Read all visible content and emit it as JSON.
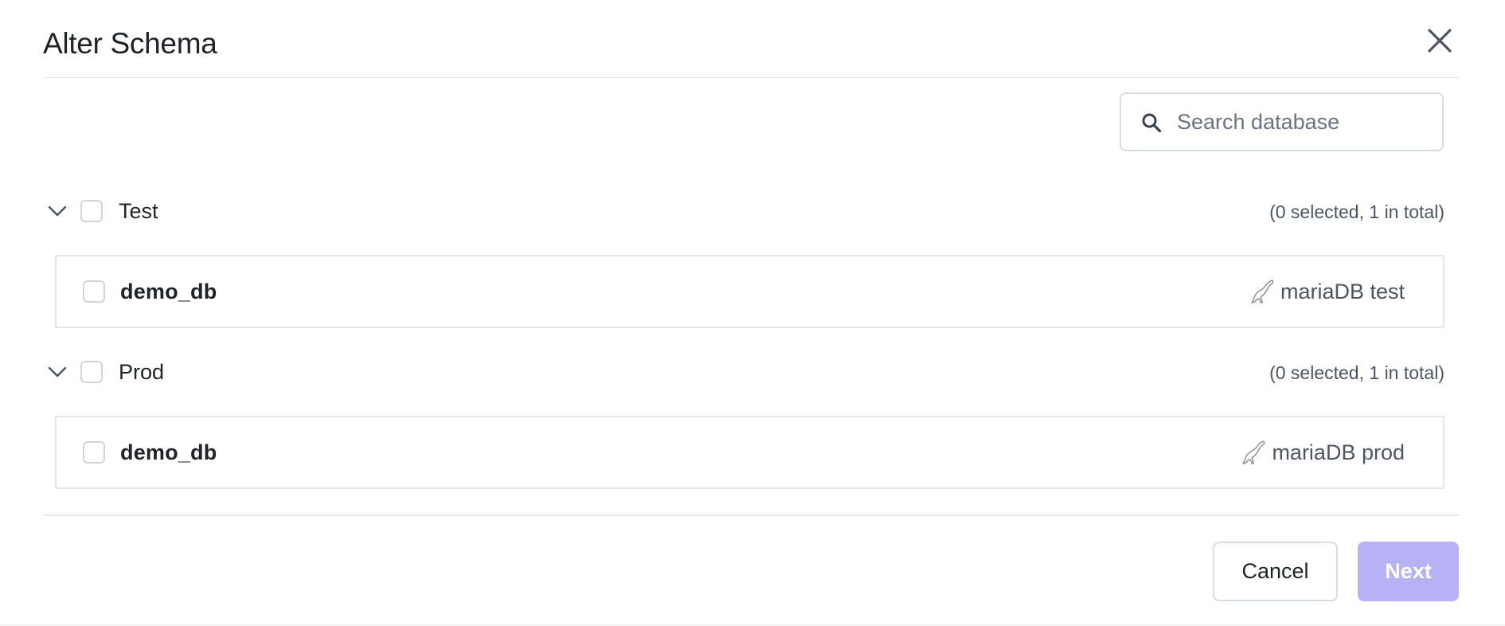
{
  "dialog": {
    "title": "Alter Schema",
    "close_icon": "close-icon"
  },
  "search": {
    "placeholder": "Search database",
    "value": "",
    "icon": "search-icon"
  },
  "groups": [
    {
      "label": "Test",
      "count_text": "(0 selected, 1 in total)",
      "expanded": true,
      "checked": false,
      "databases": [
        {
          "name": "demo_db",
          "instance": "mariaDB test",
          "icon": "mariadb-seal-icon",
          "checked": false
        }
      ]
    },
    {
      "label": "Prod",
      "count_text": "(0 selected, 1 in total)",
      "expanded": true,
      "checked": false,
      "databases": [
        {
          "name": "demo_db",
          "instance": "mariaDB prod",
          "icon": "mariadb-seal-icon",
          "checked": false
        }
      ]
    }
  ],
  "footer": {
    "cancel_label": "Cancel",
    "next_label": "Next",
    "next_disabled": true
  },
  "colors": {
    "accent_disabled": "#b6b2f5",
    "border": "#d9dce1",
    "muted_text": "#4b5563"
  }
}
